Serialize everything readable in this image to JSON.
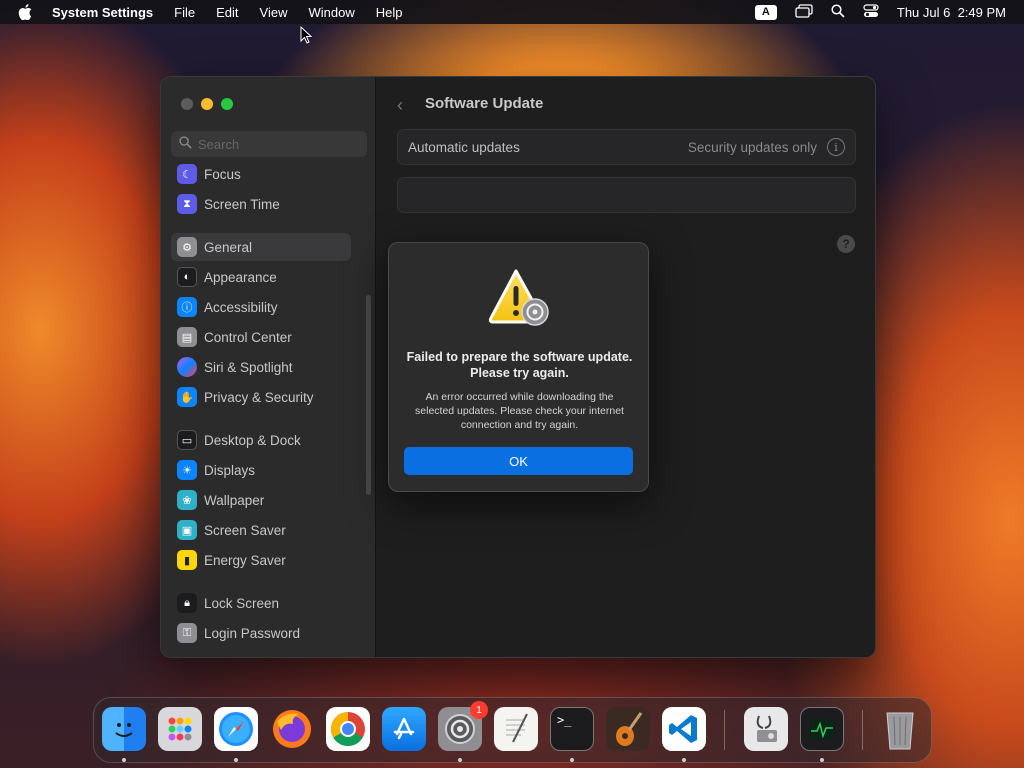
{
  "menubar": {
    "app_name": "System Settings",
    "items": [
      "File",
      "Edit",
      "View",
      "Window",
      "Help"
    ],
    "input_indicator": "A",
    "datetime": "Thu Jul 6  2:49 PM"
  },
  "sidebar": {
    "search_placeholder": "Search",
    "items": [
      {
        "label": "Focus",
        "icon": "moon-icon",
        "color": "#5e5ce6"
      },
      {
        "label": "Screen Time",
        "icon": "hourglass-icon",
        "color": "#5e5ce6"
      },
      {
        "label": "General",
        "icon": "gear-icon",
        "color": "#8e8e93"
      },
      {
        "label": "Appearance",
        "icon": "appearance-icon",
        "color": "#1c1c1e"
      },
      {
        "label": "Accessibility",
        "icon": "accessibility-icon",
        "color": "#0a84ff"
      },
      {
        "label": "Control Center",
        "icon": "control-center-icon",
        "color": "#8e8e93"
      },
      {
        "label": "Siri & Spotlight",
        "icon": "siri-icon",
        "color": "#bf5af2"
      },
      {
        "label": "Privacy & Security",
        "icon": "hand-icon",
        "color": "#0a84ff"
      },
      {
        "label": "Desktop & Dock",
        "icon": "dock-icon",
        "color": "#1c1c1e"
      },
      {
        "label": "Displays",
        "icon": "sun-icon",
        "color": "#0a84ff"
      },
      {
        "label": "Wallpaper",
        "icon": "wallpaper-icon",
        "color": "#30b0c7"
      },
      {
        "label": "Screen Saver",
        "icon": "screen-saver-icon",
        "color": "#30b0c7"
      },
      {
        "label": "Energy Saver",
        "icon": "battery-icon",
        "color": "#ffd60a"
      },
      {
        "label": "Lock Screen",
        "icon": "lock-icon",
        "color": "#1c1c1e"
      },
      {
        "label": "Login Password",
        "icon": "password-icon",
        "color": "#8e8e93"
      }
    ],
    "selected": "General"
  },
  "content": {
    "title": "Software Update",
    "automatic_updates_label": "Automatic updates",
    "automatic_updates_value": "Security updates only"
  },
  "alert": {
    "title": "Failed to prepare the software update. Please try again.",
    "message": "An error occurred while downloading the selected updates. Please check your internet connection and try again.",
    "ok_label": "OK"
  },
  "dock": {
    "apps": [
      {
        "name": "finder-icon",
        "running": true
      },
      {
        "name": "launchpad-icon",
        "running": false
      },
      {
        "name": "safari-icon",
        "running": true
      },
      {
        "name": "firefox-icon",
        "running": false
      },
      {
        "name": "chrome-icon",
        "running": false
      },
      {
        "name": "app-store-icon",
        "running": false
      },
      {
        "name": "system-settings-icon",
        "running": true,
        "badge": "1"
      },
      {
        "name": "textedit-icon",
        "running": false
      },
      {
        "name": "terminal-icon",
        "running": true
      },
      {
        "name": "garageband-icon",
        "running": false
      },
      {
        "name": "vscode-icon",
        "running": true
      },
      {
        "name": "disk-utility-icon",
        "running": false
      },
      {
        "name": "activity-monitor-icon",
        "running": true
      },
      {
        "name": "trash-icon",
        "running": false
      }
    ]
  }
}
